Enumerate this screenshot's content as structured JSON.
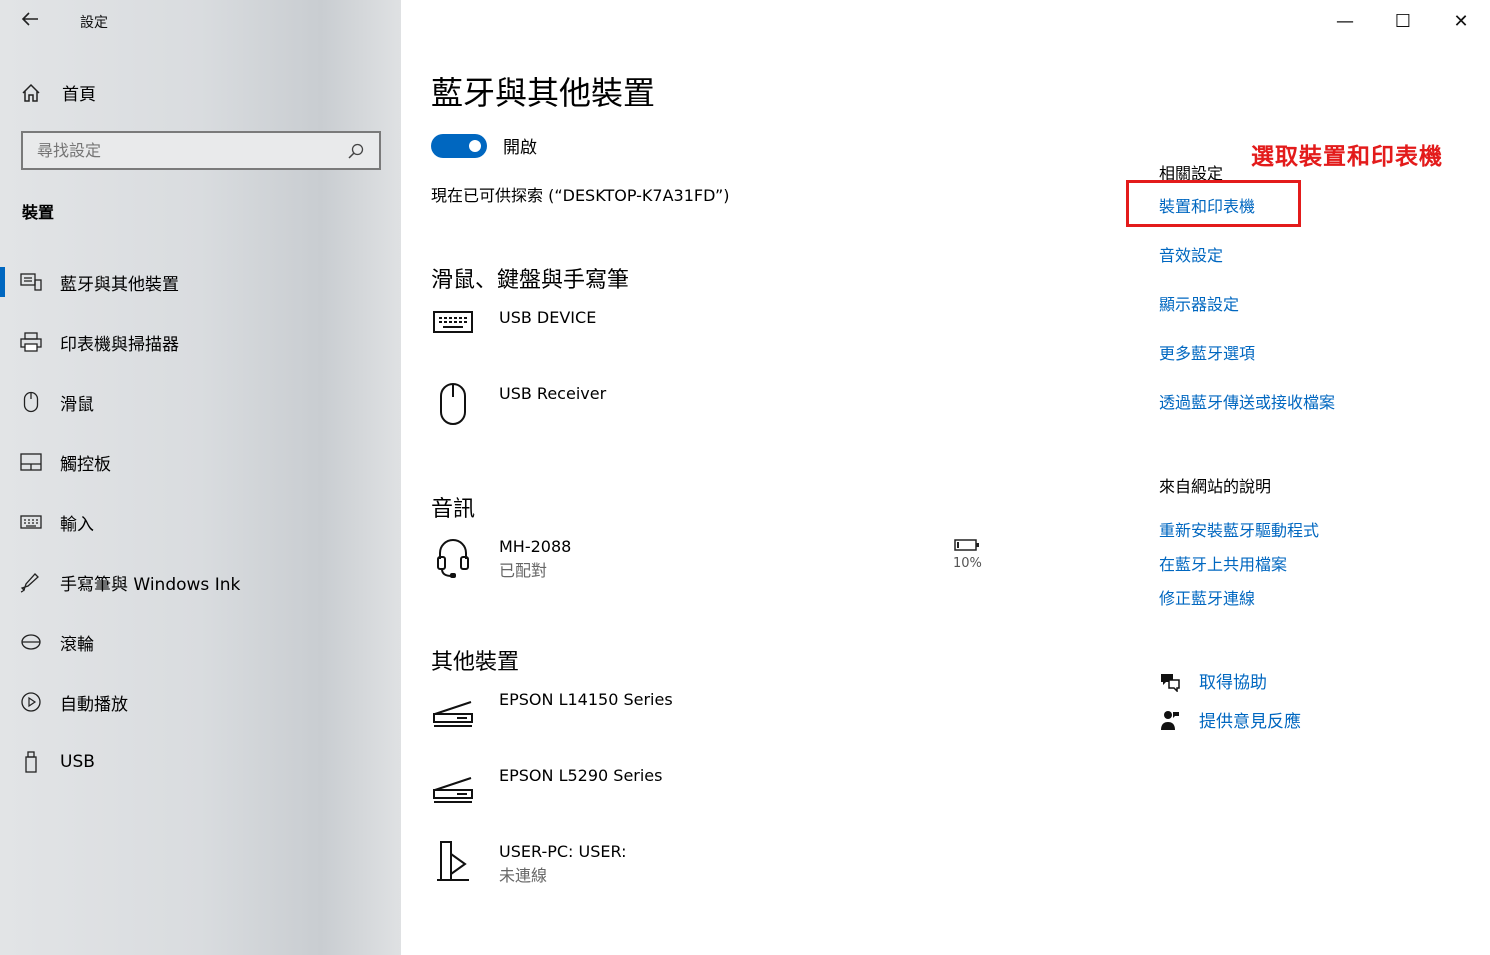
{
  "window": {
    "app_title": "設定",
    "min_glyph": "—",
    "max_glyph": "☐",
    "close_glyph": "✕"
  },
  "sidebar": {
    "home_label": "首頁",
    "search_placeholder": "尋找設定",
    "section_label": "裝置",
    "items": [
      {
        "label": "藍牙與其他裝置",
        "icon": "bluetooth-devices-icon",
        "active": true
      },
      {
        "label": "印表機與掃描器",
        "icon": "printer-icon"
      },
      {
        "label": "滑鼠",
        "icon": "mouse-icon"
      },
      {
        "label": "觸控板",
        "icon": "touchpad-icon"
      },
      {
        "label": "輸入",
        "icon": "keyboard-icon"
      },
      {
        "label": "手寫筆與 Windows Ink",
        "icon": "pen-icon"
      },
      {
        "label": "滾輪",
        "icon": "wheel-icon"
      },
      {
        "label": "自動播放",
        "icon": "autoplay-icon"
      },
      {
        "label": "USB",
        "icon": "usb-icon"
      }
    ]
  },
  "main": {
    "title": "藍牙與其他裝置",
    "bluetooth_toggle_label": "開啟",
    "discoverable_text": "現在已可供探索 (“DESKTOP-K7A31FD”)",
    "groups": {
      "input_title": "滑鼠、鍵盤與手寫筆",
      "audio_title": "音訊",
      "other_title": "其他裝置"
    },
    "devices": {
      "usb_device": {
        "name": "USB DEVICE"
      },
      "usb_receiver": {
        "name": "USB Receiver"
      },
      "headset": {
        "name": "MH-2088",
        "status": "已配對",
        "battery": "10%"
      },
      "epson1": {
        "name": "EPSON L14150 Series"
      },
      "epson2": {
        "name": "EPSON L5290 Series"
      },
      "userpc": {
        "name": "USER-PC: USER:",
        "status": "未連線"
      }
    }
  },
  "related": {
    "heading": "相關設定",
    "links": [
      "裝置和印表機",
      "音效設定",
      "顯示器設定",
      "更多藍牙選項",
      "透過藍牙傳送或接收檔案"
    ],
    "web_heading": "來自網站的說明",
    "web_links": [
      "重新安裝藍牙驅動程式",
      "在藍牙上共用檔案",
      "修正藍牙連線"
    ],
    "get_help": "取得協助",
    "feedback": "提供意見反應"
  },
  "annotation": {
    "text": "選取裝置和印表機",
    "color": "#e31b1b"
  },
  "colors": {
    "accent": "#0067c0",
    "highlight": "#e31b1b"
  }
}
